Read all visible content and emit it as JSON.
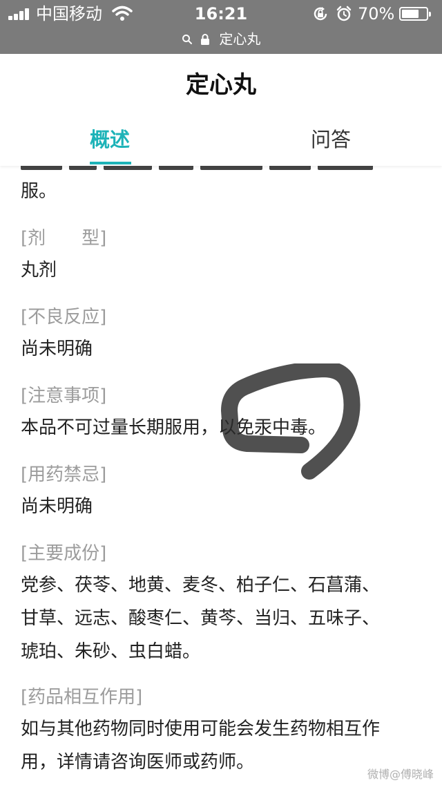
{
  "status_bar": {
    "carrier": "中国移动",
    "time": "16:21",
    "battery_percent": "70%",
    "battery_level": 0.7,
    "url_text": "定心丸"
  },
  "header": {
    "title": "定心丸",
    "tabs": [
      {
        "label": "概述",
        "active": true
      },
      {
        "label": "问答",
        "active": false
      }
    ]
  },
  "content": {
    "lead_tail": "服。",
    "sections": [
      {
        "heading": "[剂　　型]",
        "lines": [
          "丸剂"
        ]
      },
      {
        "heading": "[不良反应]",
        "lines": [
          "尚未明确"
        ]
      },
      {
        "heading": "[注意事项]",
        "lines": [
          "本品不可过量长期服用，以免汞中毒。"
        ]
      },
      {
        "heading": "[用药禁忌]",
        "lines": [
          "尚未明确"
        ]
      },
      {
        "heading": "[主要成份]",
        "lines": [
          "党参、茯苓、地黄、麦冬、柏子仁、石菖蒲、",
          "甘草、远志、酸枣仁、黄芩、当归、五味子、",
          "琥珀、朱砂、虫白蜡。"
        ]
      },
      {
        "heading": "[药品相互作用]",
        "lines": [
          "如与其他药物同时使用可能会发生药物相互作",
          "用，详情请咨询医师或药师。"
        ]
      }
    ]
  },
  "watermark": "微博@傅晓峰",
  "colors": {
    "accent": "#1db3b8",
    "status_bar_bg": "#7b7b7b",
    "heading_text": "#9c9c9c",
    "body_text": "#222222",
    "marker": "#2a2a2a"
  },
  "icons": [
    "signal-icon",
    "wifi-icon",
    "rotation-lock-icon",
    "alarm-icon",
    "battery-icon",
    "search-icon",
    "padlock-icon",
    "hand-drawn-circle-mark"
  ]
}
